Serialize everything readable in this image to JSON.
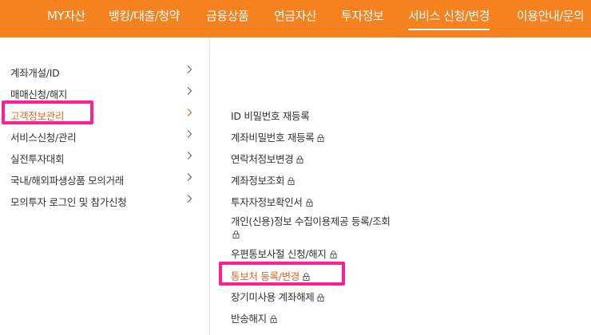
{
  "top_nav": {
    "items": [
      {
        "label": "MY자산"
      },
      {
        "label": "뱅킹/대출/청약"
      },
      {
        "label": "금융상품"
      },
      {
        "label": "연금자산"
      },
      {
        "label": "투자정보"
      },
      {
        "label": "서비스 신청/변경",
        "active": true
      },
      {
        "label": "이용안내/문의"
      }
    ],
    "background": "#f5821f"
  },
  "left_menu": {
    "items": [
      {
        "label": "계좌개설/ID"
      },
      {
        "label": "매매신청/해지"
      },
      {
        "label": "고객정보관리",
        "active": true
      },
      {
        "label": "서비스신청/관리"
      },
      {
        "label": "실전투자대회"
      },
      {
        "label": "국내/해외파생상품 모의거래"
      },
      {
        "label": "모의투자 로그인 및 참가신청"
      }
    ],
    "chevron_icon": "chevron-right-icon"
  },
  "sub_menu": {
    "items": [
      {
        "label": "ID 비밀번호 재등록",
        "locked": false
      },
      {
        "label": "계좌비밀번호 재등록",
        "locked": true
      },
      {
        "label": "연락처정보변경",
        "locked": true
      },
      {
        "label": "계좌정보조회",
        "locked": true
      },
      {
        "label": "투자자정보확인서",
        "locked": true
      },
      {
        "label": "개인(신용)정보 수집이용제공 등록/조회",
        "locked": true
      },
      {
        "label": "우편통보사절 신청/해지",
        "locked": true
      },
      {
        "label": "통보처 등록/변경",
        "locked": true,
        "active": true
      },
      {
        "label": "장기미사용 계좌해제",
        "locked": true
      },
      {
        "label": "반송해지",
        "locked": true
      }
    ],
    "lock_icon": "lock-icon"
  },
  "colors": {
    "accent": "#f5821f",
    "active_text": "#e0662a",
    "highlight": "#ff1f96"
  }
}
